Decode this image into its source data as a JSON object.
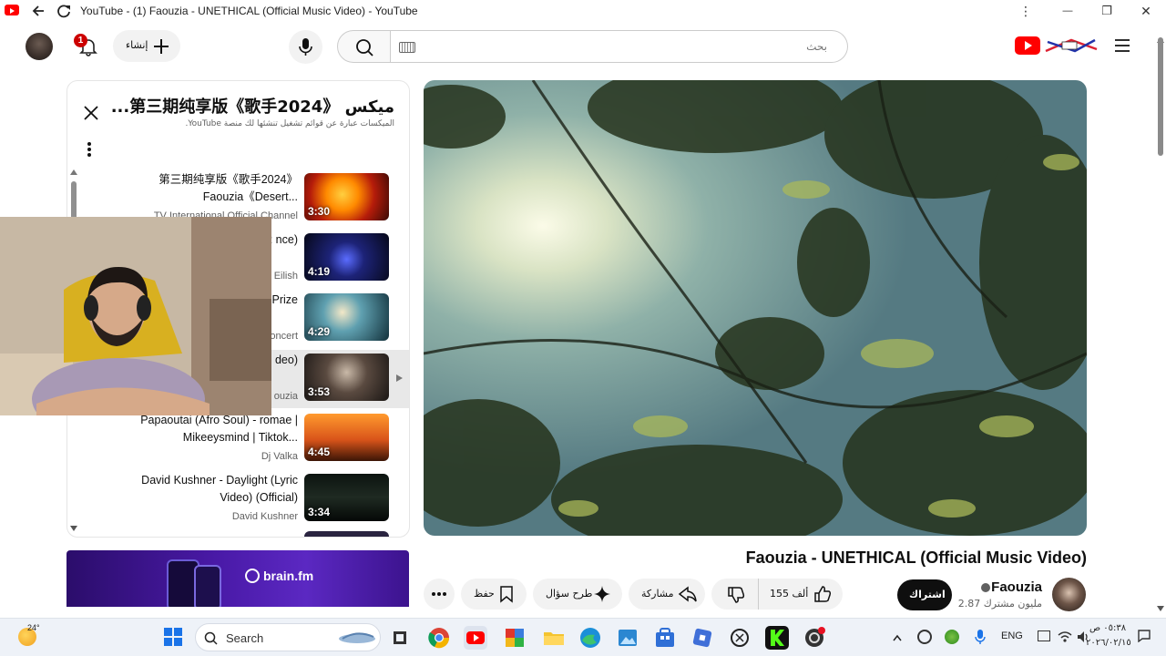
{
  "window": {
    "title": "YouTube - (1) Faouzia - UNETHICAL (Official Music Video) - YouTube",
    "menu_glyph": "⋮",
    "min_glyph": "—",
    "max_glyph": "❐",
    "close_glyph": "✕"
  },
  "masthead": {
    "notification_count": "1",
    "create_label": "إنشاء",
    "search_placeholder": "بحث"
  },
  "playlist": {
    "title": "ميكس 《歌手2024》第三期纯享版...",
    "subtitle": "الميكسات عبارة عن قوائم تشغيل تنشئها لك منصة YouTube.",
    "items": [
      {
        "title": "第三期纯享版《歌手2024》 Faouzia《Desert...",
        "channel": "TV International Official Channel",
        "duration": "3:30"
      },
      {
        "title": "WER nce)",
        "channel": "Eilish",
        "duration": "4:19"
      },
      {
        "title": "The Prize",
        "channel": "oncert",
        "duration": "4:29"
      },
      {
        "title": "ficial deo)",
        "channel": "ouzia",
        "duration": "3:53"
      },
      {
        "title": "Papaoutai (Afro Soul) - romae | Mikeeysmind | Tiktok...",
        "channel": "Dj Valka",
        "duration": "4:45"
      },
      {
        "title": "David Kushner - Daylight (Lyric Video) (Official)",
        "channel": "David Kushner",
        "duration": "3:34"
      }
    ]
  },
  "ad": {
    "brand": "brain.fm"
  },
  "video": {
    "title": "Faouzia - UNETHICAL (Official Music Video)",
    "channel": "Faouzia",
    "subscribers": "2.87 مليون مشترك",
    "subscribe_label": "اشتراك",
    "likes": "155 ألف",
    "share_label": "مشاركة",
    "ask_label": "طرح سؤال",
    "save_label": "حفظ"
  },
  "taskbar": {
    "weather_temp": "24°",
    "search_label": "Search",
    "lang": "ENG",
    "time": "٠٥:٣٨ ص",
    "date": "٢٠٢٦/٠٢/١٥"
  }
}
